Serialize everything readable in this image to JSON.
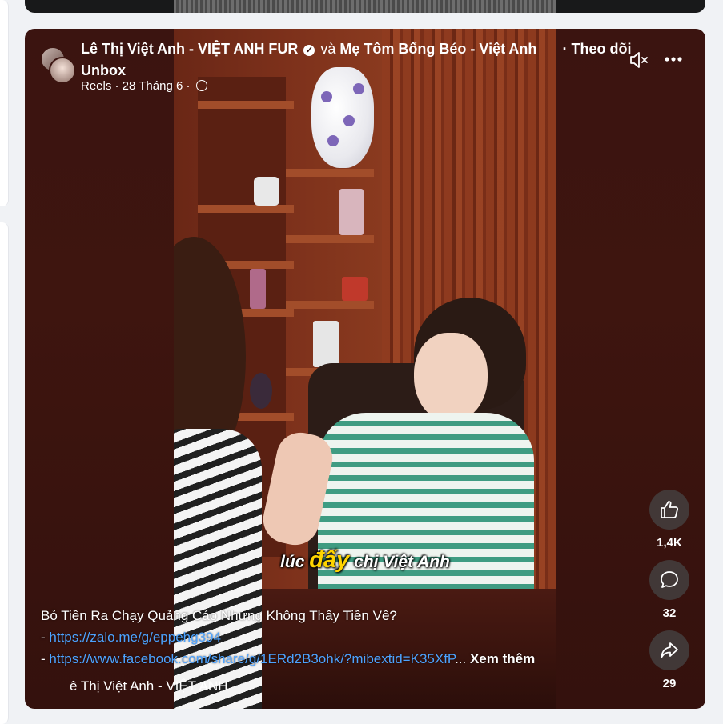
{
  "post": {
    "author1": "Lê Thị Việt Anh - VIỆT ANH FUR",
    "joiner": "và",
    "author2": "Mẹ Tôm Bống Béo - Việt Anh",
    "sep": "·",
    "follow_label": "Theo dõi",
    "author2_cont": "Unbox",
    "meta": "Reels · 28 Tháng 6 ·"
  },
  "video": {
    "subtitle_pre": "lúc ",
    "subtitle_em": "đấy",
    "subtitle_post": " chị Việt Anh"
  },
  "actions": {
    "likes": "1,4K",
    "comments": "32",
    "shares": "29"
  },
  "description": {
    "line1": "Bỏ Tiền Ra Chạy Quảng Cáo Nhưng Không Thấy Tiền Về?",
    "prefix": "- ",
    "link1": "https://zalo.me/g/eppehg394",
    "link2": "https://www.facebook.com/share/g/1ERd2B3ohk/?mibextid=K35XfP",
    "ellipsis": "...",
    "see_more": "Xem thêm"
  },
  "audio": {
    "label": "ê Thị Việt Anh - VIỆT ANH"
  },
  "icons": {
    "mute": "speaker-muted-icon",
    "more": "more-horizontal-icon",
    "like": "thumbs-up-icon",
    "comment": "comment-bubble-icon",
    "share": "share-arrow-icon",
    "verified": "verified-badge-icon",
    "privacy": "globe-icon"
  },
  "colors": {
    "link": "#4da3ff",
    "caption_highlight": "#ffd400",
    "reel_bg": "#3b1410"
  }
}
